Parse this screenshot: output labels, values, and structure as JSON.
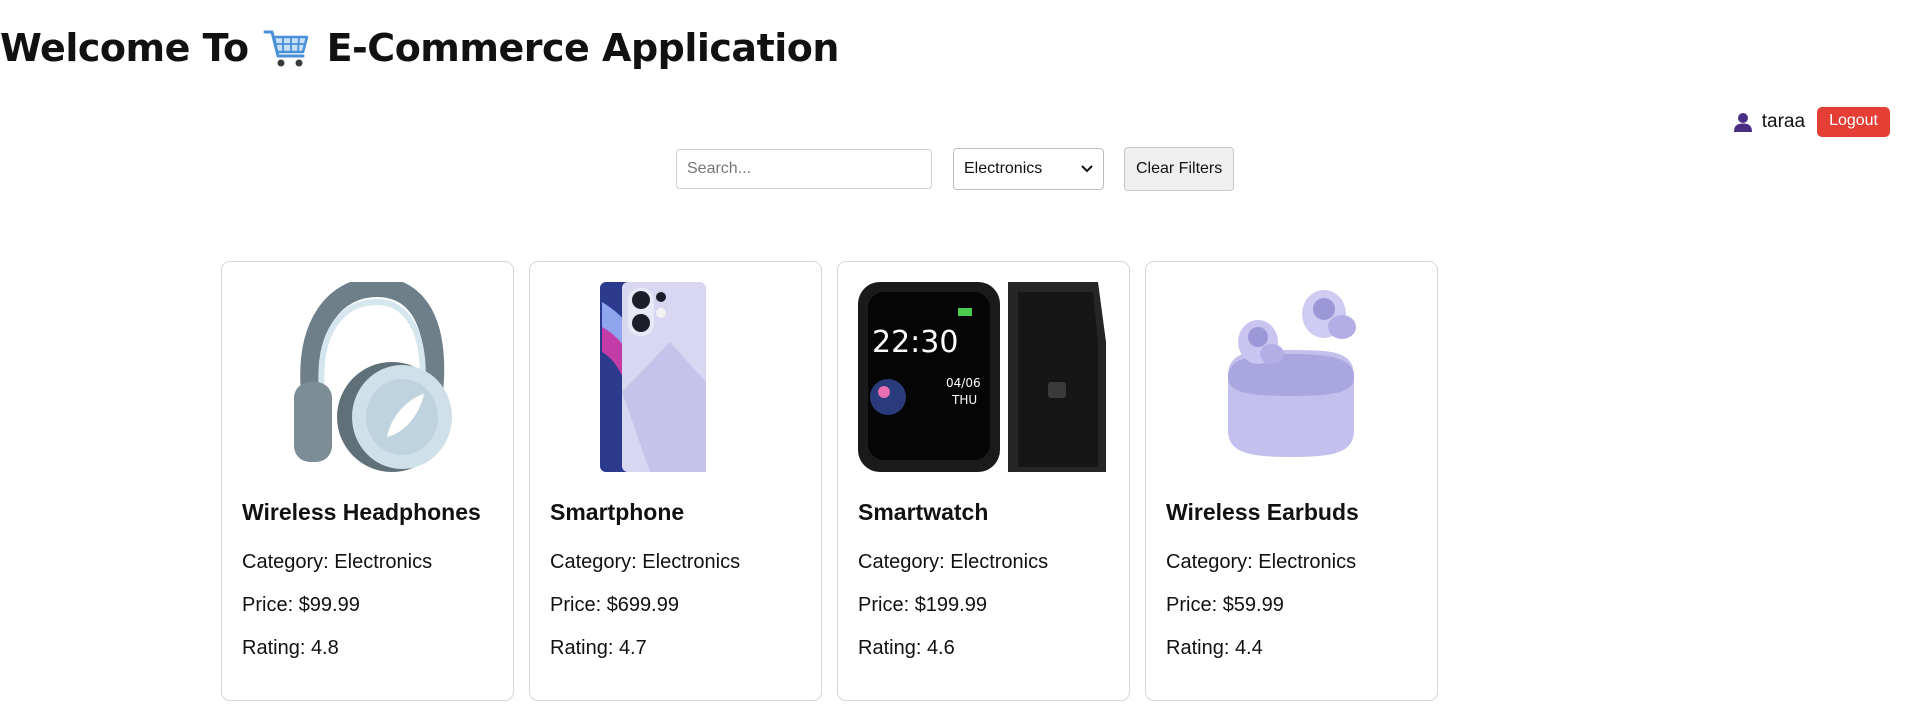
{
  "header": {
    "title_prefix": "Welcome To",
    "title_suffix": "E-Commerce Application",
    "title_icon": "shopping-cart-icon"
  },
  "user": {
    "icon": "user-icon",
    "username": "taraa",
    "logout_label": "Logout",
    "logout_color": "#e53e35"
  },
  "filters": {
    "search_placeholder": "Search...",
    "search_value": "",
    "category_selected": "Electronics",
    "clear_label": "Clear Filters"
  },
  "labels": {
    "category": "Category:",
    "price": "Price:",
    "rating": "Rating:"
  },
  "products": [
    {
      "name": "Wireless Headphones",
      "category": "Electronics",
      "price": "$99.99",
      "rating": "4.8",
      "image": "headphones-image"
    },
    {
      "name": "Smartphone",
      "category": "Electronics",
      "price": "$699.99",
      "rating": "4.7",
      "image": "smartphone-image"
    },
    {
      "name": "Smartwatch",
      "category": "Electronics",
      "price": "$199.99",
      "rating": "4.6",
      "image": "smartwatch-image"
    },
    {
      "name": "Wireless Earbuds",
      "category": "Electronics",
      "price": "$59.99",
      "rating": "4.4",
      "image": "earbuds-image"
    }
  ]
}
